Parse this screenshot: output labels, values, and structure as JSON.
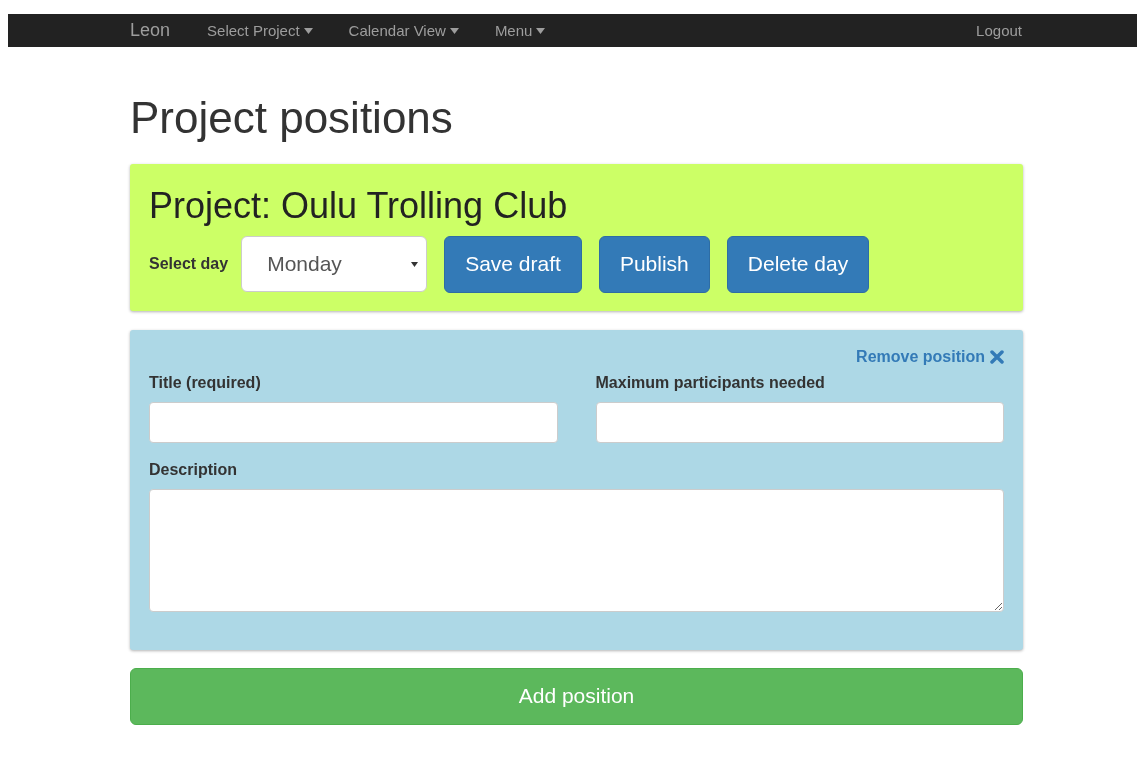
{
  "navbar": {
    "brand": "Leon",
    "menus": [
      {
        "label": "Select Project"
      },
      {
        "label": "Calendar View"
      },
      {
        "label": "Menu"
      }
    ],
    "logout": "Logout"
  },
  "heading": "Project positions",
  "project": {
    "title": "Project: Oulu Trolling Club",
    "day_label": "Select day",
    "day_value": "Monday",
    "buttons": [
      "Save draft",
      "Publish",
      "Delete day"
    ]
  },
  "positions": [
    {
      "remove": "Remove position",
      "fields": [
        {
          "label": "Title (required)",
          "kind": "input"
        },
        {
          "label": "Maximum participants needed",
          "kind": "input"
        },
        {
          "label": "Description",
          "kind": "textarea"
        }
      ]
    }
  ],
  "add_button": "Add position"
}
